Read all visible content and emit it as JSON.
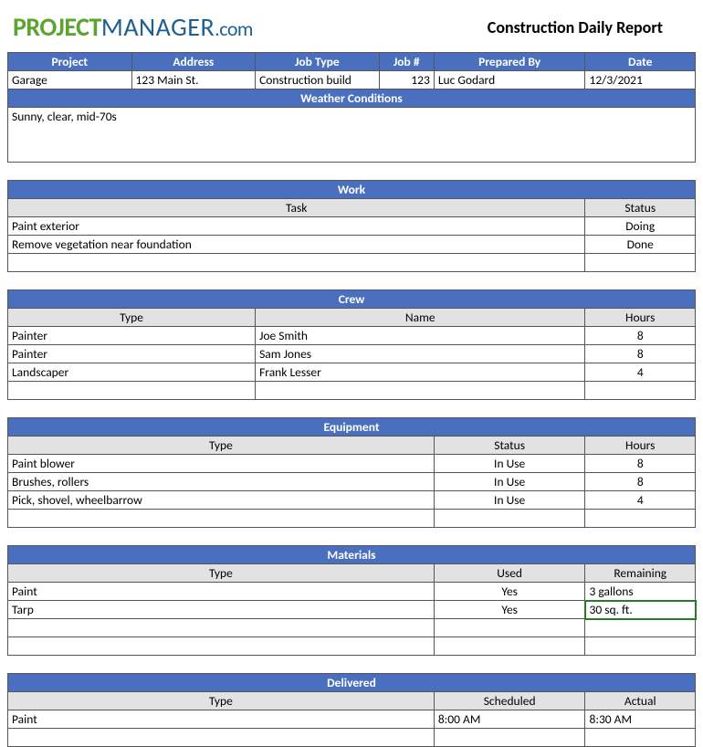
{
  "logo": {
    "part1": "PROJECT",
    "part2": "MANAGER",
    "part3": ".com"
  },
  "title": "Construction Daily Report",
  "info_headers": {
    "project": "Project",
    "address": "Address",
    "job_type": "Job Type",
    "job_num": "Job #",
    "prepared_by": "Prepared By",
    "date": "Date"
  },
  "info": {
    "project": "Garage",
    "address": "123 Main St.",
    "job_type": "Construction build",
    "job_num": "123",
    "prepared_by": "Luc Godard",
    "date": "12/3/2021"
  },
  "weather": {
    "header": "Weather Conditions",
    "value": "Sunny, clear, mid-70s"
  },
  "work": {
    "header": "Work",
    "cols": {
      "task": "Task",
      "status": "Status"
    },
    "rows": [
      {
        "task": "Paint exterior",
        "status": "Doing"
      },
      {
        "task": "Remove vegetation near foundation",
        "status": "Done"
      },
      {
        "task": "",
        "status": ""
      }
    ]
  },
  "crew": {
    "header": "Crew",
    "cols": {
      "type": "Type",
      "name": "Name",
      "hours": "Hours"
    },
    "rows": [
      {
        "type": "Painter",
        "name": "Joe Smith",
        "hours": "8"
      },
      {
        "type": "Painter",
        "name": "Sam Jones",
        "hours": "8"
      },
      {
        "type": "Landscaper",
        "name": "Frank Lesser",
        "hours": "4"
      },
      {
        "type": "",
        "name": "",
        "hours": ""
      }
    ]
  },
  "equipment": {
    "header": "Equipment",
    "cols": {
      "type": "Type",
      "status": "Status",
      "hours": "Hours"
    },
    "rows": [
      {
        "type": "Paint blower",
        "status": "In Use",
        "hours": "8"
      },
      {
        "type": "Brushes, rollers",
        "status": "In Use",
        "hours": "8"
      },
      {
        "type": "Pick, shovel, wheelbarrow",
        "status": "In Use",
        "hours": "4"
      },
      {
        "type": "",
        "status": "",
        "hours": ""
      }
    ]
  },
  "materials": {
    "header": "Materials",
    "cols": {
      "type": "Type",
      "used": "Used",
      "remaining": "Remaining"
    },
    "rows": [
      {
        "type": "Paint",
        "used": "Yes",
        "remaining": "3 gallons"
      },
      {
        "type": "Tarp",
        "used": "Yes",
        "remaining": "30 sq. ft."
      },
      {
        "type": "",
        "used": "",
        "remaining": ""
      },
      {
        "type": "",
        "used": "",
        "remaining": ""
      }
    ]
  },
  "delivered": {
    "header": "Delivered",
    "cols": {
      "type": "Type",
      "scheduled": "Scheduled",
      "actual": "Actual"
    },
    "rows": [
      {
        "type": "Paint",
        "scheduled": "8:00 AM",
        "actual": "8:30 AM"
      },
      {
        "type": "",
        "scheduled": "",
        "actual": ""
      }
    ]
  }
}
